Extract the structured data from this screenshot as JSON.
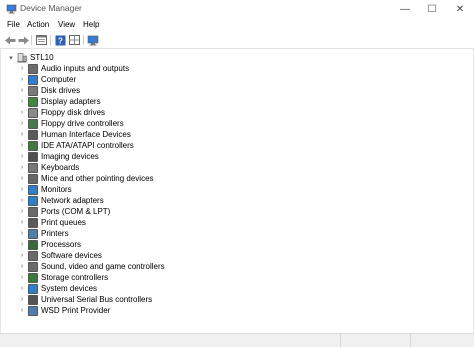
{
  "window": {
    "title": "Device Manager",
    "controls": {
      "minimize": "—",
      "maximize": "☐",
      "close": "✕"
    }
  },
  "menu": [
    "File",
    "Action",
    "View",
    "Help"
  ],
  "toolbar": [
    "back-arrow-icon",
    "forward-arrow-icon",
    "properties-icon",
    "help-icon",
    "scan-hardware-icon"
  ],
  "tree": {
    "root": {
      "label": "STL10",
      "icon": "computer-icon"
    },
    "items": [
      {
        "label": "Audio inputs and outputs",
        "icon": "speaker-icon",
        "color": "#6b6b6b"
      },
      {
        "label": "Computer",
        "icon": "monitor-icon",
        "color": "#2f7fd0"
      },
      {
        "label": "Disk drives",
        "icon": "disk-drive-icon",
        "color": "#7a7a7a"
      },
      {
        "label": "Display adapters",
        "icon": "display-adapter-icon",
        "color": "#3b8a3b"
      },
      {
        "label": "Floppy disk drives",
        "icon": "floppy-icon",
        "color": "#8a8a8a"
      },
      {
        "label": "Floppy drive controllers",
        "icon": "controller-icon",
        "color": "#4a7a4a"
      },
      {
        "label": "Human Interface Devices",
        "icon": "hid-icon",
        "color": "#5b5b5b"
      },
      {
        "label": "IDE ATA/ATAPI controllers",
        "icon": "ide-controller-icon",
        "color": "#3f7a3f"
      },
      {
        "label": "Imaging devices",
        "icon": "camera-icon",
        "color": "#505050"
      },
      {
        "label": "Keyboards",
        "icon": "keyboard-icon",
        "color": "#777777"
      },
      {
        "label": "Mice and other pointing devices",
        "icon": "mouse-icon",
        "color": "#666666"
      },
      {
        "label": "Monitors",
        "icon": "monitor-icon",
        "color": "#2f7fd0"
      },
      {
        "label": "Network adapters",
        "icon": "network-icon",
        "color": "#2f7fd0"
      },
      {
        "label": "Ports (COM & LPT)",
        "icon": "port-icon",
        "color": "#6a6a6a"
      },
      {
        "label": "Print queues",
        "icon": "print-queue-icon",
        "color": "#5a5a5a"
      },
      {
        "label": "Printers",
        "icon": "printer-icon",
        "color": "#4a7fb0"
      },
      {
        "label": "Processors",
        "icon": "processor-icon",
        "color": "#3a6a3a"
      },
      {
        "label": "Software devices",
        "icon": "software-device-icon",
        "color": "#6a6a6a"
      },
      {
        "label": "Sound, video and game controllers",
        "icon": "sound-icon",
        "color": "#6a6a6a"
      },
      {
        "label": "Storage controllers",
        "icon": "storage-icon",
        "color": "#3a7a3a"
      },
      {
        "label": "System devices",
        "icon": "system-icon",
        "color": "#2f7fd0"
      },
      {
        "label": "Universal Serial Bus controllers",
        "icon": "usb-icon",
        "color": "#555555"
      },
      {
        "label": "WSD Print Provider",
        "icon": "wsd-icon",
        "color": "#4a7fb0"
      }
    ]
  }
}
